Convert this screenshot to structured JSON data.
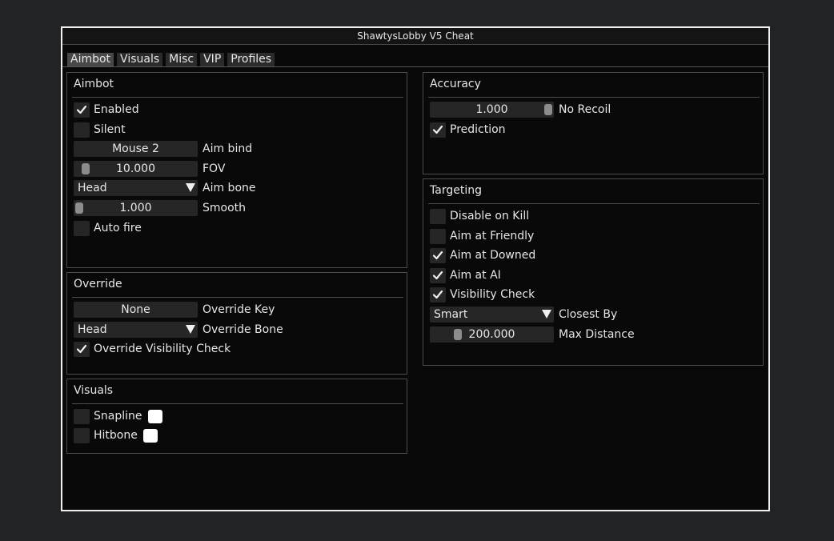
{
  "window": {
    "title": "ShawtysLobby V5 Cheat"
  },
  "tabs": [
    "Aimbot",
    "Visuals",
    "Misc",
    "VIP",
    "Profiles"
  ],
  "active_tab": "Aimbot",
  "aimbot": {
    "title": "Aimbot",
    "enabled_label": "Enabled",
    "enabled": true,
    "silent_label": "Silent",
    "silent": false,
    "aim_bind_value": "Mouse 2",
    "aim_bind_label": "Aim bind",
    "fov_value": "10.000",
    "fov_label": "FOV",
    "aim_bone_value": "Head",
    "aim_bone_label": "Aim bone",
    "smooth_value": "1.000",
    "smooth_label": "Smooth",
    "auto_fire_label": "Auto fire",
    "auto_fire": false
  },
  "override": {
    "title": "Override",
    "key_value": "None",
    "key_label": "Override Key",
    "bone_value": "Head",
    "bone_label": "Override Bone",
    "visibility_label": "Override Visibility Check",
    "visibility": true
  },
  "visuals": {
    "title": "Visuals",
    "snapline_label": "Snapline",
    "snapline": false,
    "snapline_color": "#ffffff",
    "hitbone_label": "Hitbone",
    "hitbone": false,
    "hitbone_color": "#ffffff"
  },
  "accuracy": {
    "title": "Accuracy",
    "recoil_value": "1.000",
    "recoil_label": "No Recoil",
    "prediction_label": "Prediction",
    "prediction": true
  },
  "targeting": {
    "title": "Targeting",
    "disable_on_kill_label": "Disable on Kill",
    "disable_on_kill": false,
    "aim_friendly_label": "Aim at Friendly",
    "aim_friendly": false,
    "aim_downed_label": "Aim at Downed",
    "aim_downed": true,
    "aim_ai_label": "Aim at AI",
    "aim_ai": true,
    "visibility_label": "Visibility Check",
    "visibility": true,
    "closest_by_value": "Smart",
    "closest_by_label": "Closest By",
    "max_distance_value": "200.000",
    "max_distance_label": "Max Distance"
  },
  "colors": {
    "window_bg": "#090909",
    "control_bg": "#262626",
    "border": "#4c4c4c",
    "frame": "#f0f0f0"
  }
}
